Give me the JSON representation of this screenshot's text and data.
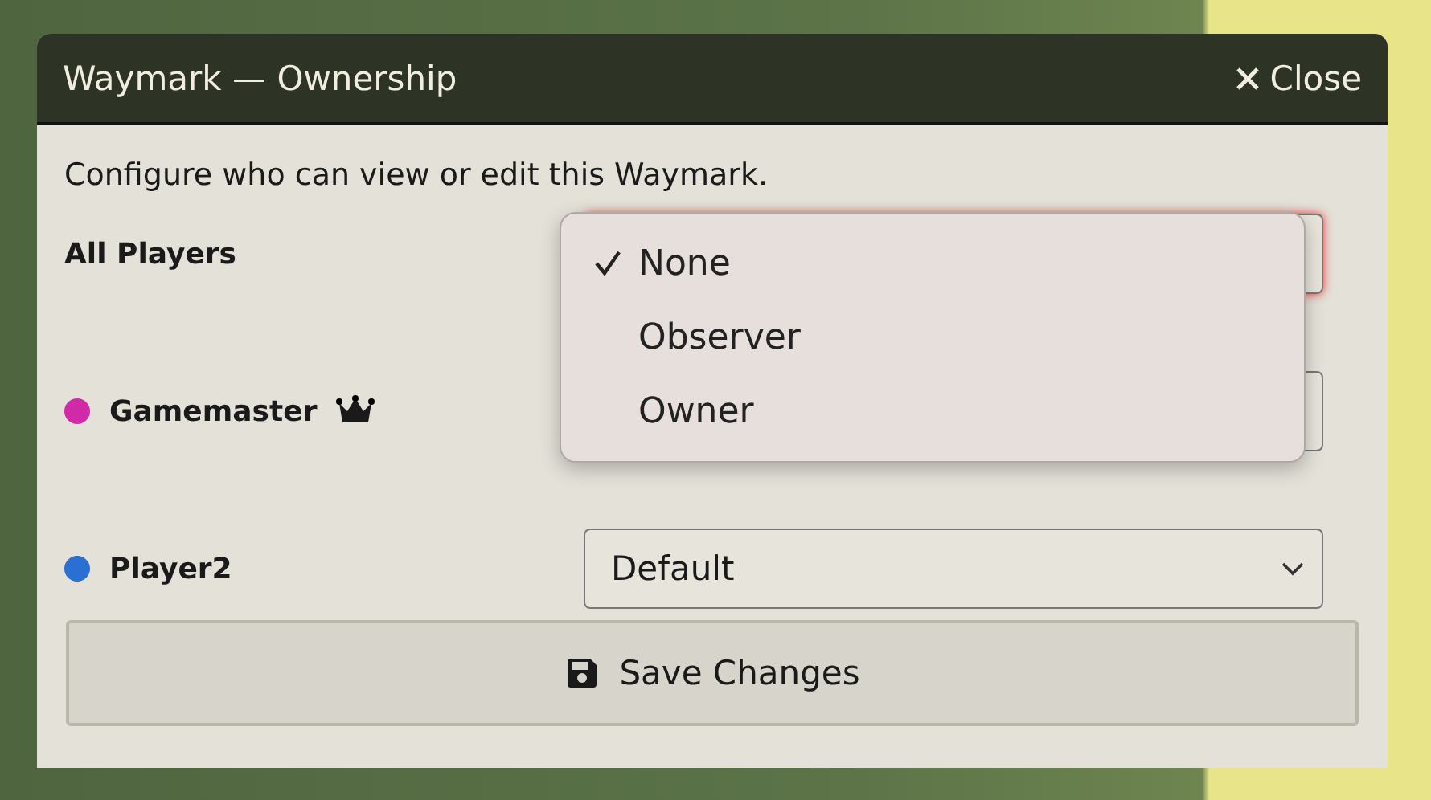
{
  "window": {
    "title": "Waymark — Ownership",
    "close_label": "Close"
  },
  "description": "Configure who can view or edit this Waymark.",
  "rows": [
    {
      "name": "All Players",
      "kind": "default",
      "focused": true
    },
    {
      "name": "Gamemaster",
      "kind": "user",
      "color": "#d12aa8",
      "gm": true,
      "focused": false
    },
    {
      "name": "Player2",
      "kind": "user",
      "color": "#2a6fd1",
      "gm": false,
      "focused": false,
      "value": "Default"
    }
  ],
  "menu": [
    {
      "label": "None",
      "selected": true
    },
    {
      "label": "Observer",
      "selected": false
    },
    {
      "label": "Owner",
      "selected": false
    }
  ],
  "save_label": "Save Changes"
}
